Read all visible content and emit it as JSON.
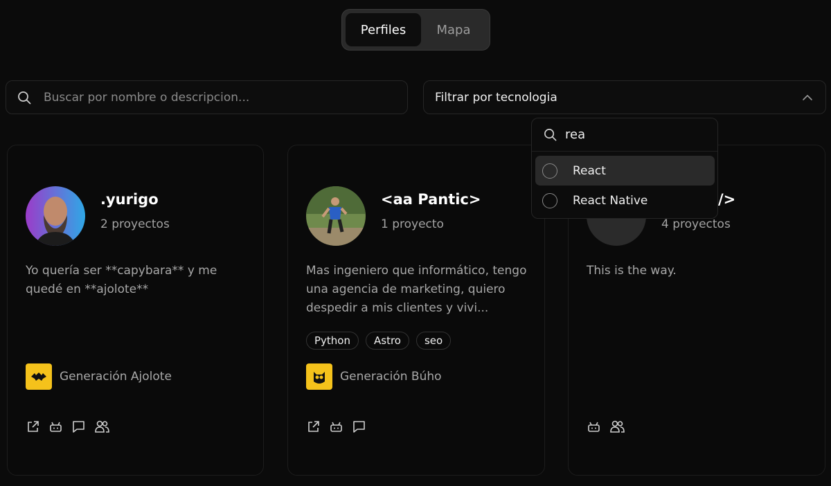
{
  "tabs": [
    {
      "label": "Perfiles",
      "active": true
    },
    {
      "label": "Mapa",
      "active": false
    }
  ],
  "search": {
    "placeholder": "Buscar por nombre o descripcion...",
    "value": ""
  },
  "filter": {
    "label": "Filtrar por tecnologia",
    "icon": "chevron-up-icon"
  },
  "dropdown": {
    "search_value": "rea",
    "options": [
      {
        "label": "React",
        "highlighted": true
      },
      {
        "label": "React Native",
        "highlighted": false
      }
    ]
  },
  "cards": [
    {
      "name": ".yurigo",
      "projects": "2 proyectos",
      "description": "Yo quería ser **capybara** y me quedé en **ajolote**",
      "tags": [],
      "generation": "Generación Ajolote",
      "actions": [
        "external-link-icon",
        "bot-icon",
        "message-icon",
        "users-icon"
      ]
    },
    {
      "name": "<aa Pantic>",
      "projects": "1 proyecto",
      "description": "Mas ingeniero que informático, tengo una agencia de marketing, quiero despedir a mis clientes y vivi...",
      "tags": [
        "Python",
        "Astro",
        "seo"
      ],
      "generation": "Generación Búho",
      "actions": [
        "external-link-icon",
        "bot-icon",
        "message-icon"
      ]
    },
    {
      "name": "/>",
      "projects": "4 proyectos",
      "description": "This is the way.",
      "tags": [],
      "generation": "",
      "actions": [
        "bot-icon",
        "users-icon"
      ]
    }
  ],
  "colors": {
    "background": "#0b0b0b",
    "generation_badge": "#f5c21b",
    "highlight": "#2a2a2a"
  }
}
